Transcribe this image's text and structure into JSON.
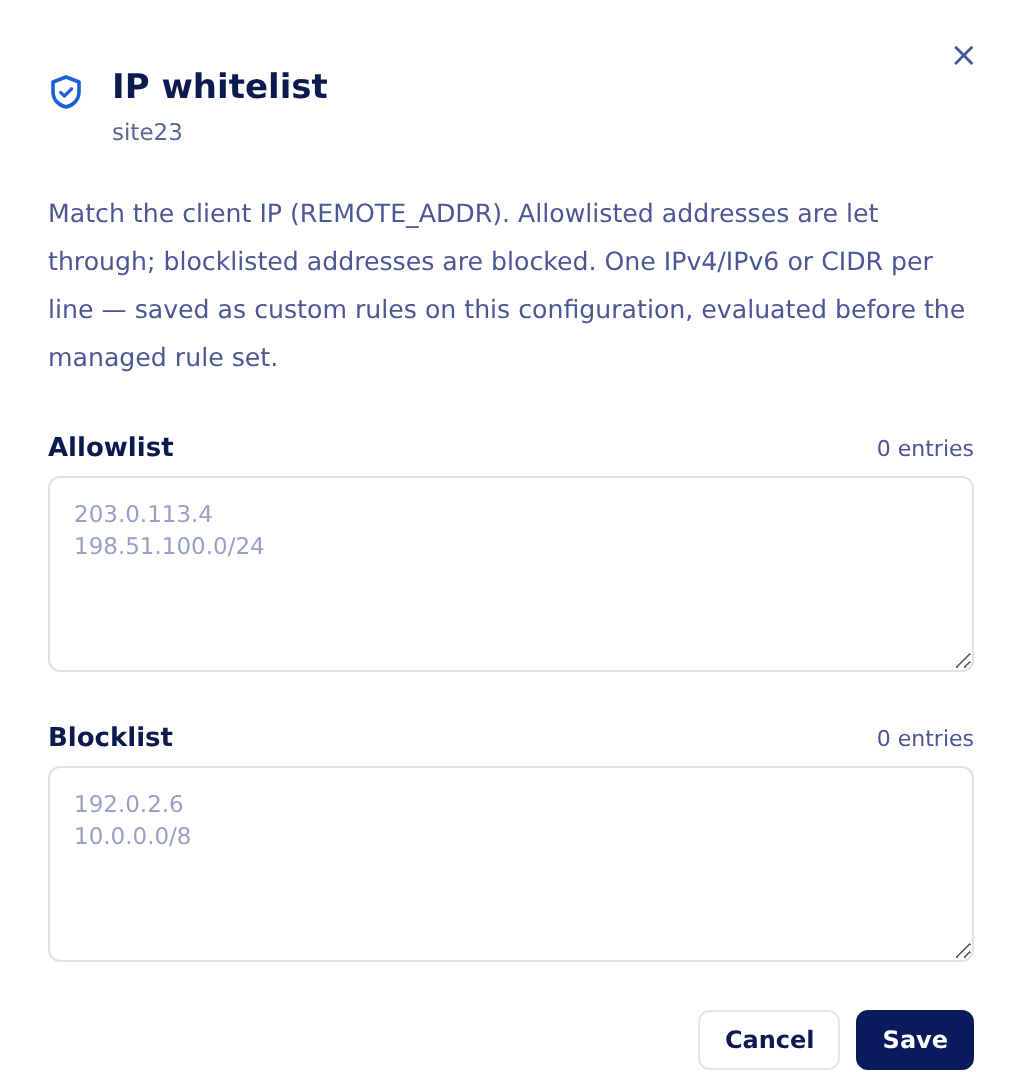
{
  "dialog": {
    "title": "IP whitelist",
    "subtitle": "site23",
    "close": "×"
  },
  "description": "Match the client IP (REMOTE_ADDR). Allowlisted addresses are let through; blocklisted addresses are blocked. One IPv4/IPv6 or CIDR per line — saved as custom rules on this configuration, evaluated before the managed rule set.",
  "lists": [
    {
      "label": "Allowlist",
      "count": "0 entries",
      "placeholder": "203.0.113.4\n198.51.100.0/24"
    },
    {
      "label": "Blocklist",
      "count": "0 entries",
      "placeholder": "192.0.2.6\n10.0.0.0/8"
    }
  ],
  "buttons": [
    {
      "label": "Cancel",
      "kind": "secondary"
    },
    {
      "label": "Save",
      "kind": "primary"
    }
  ]
}
